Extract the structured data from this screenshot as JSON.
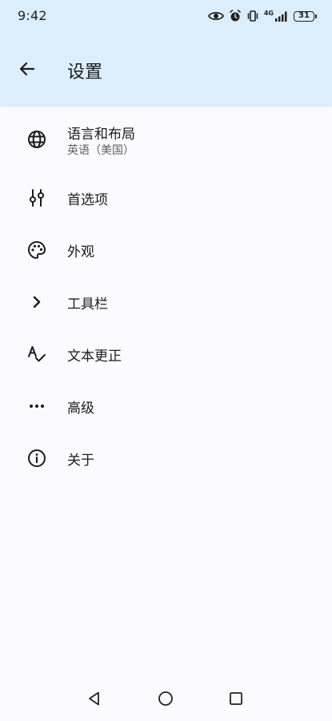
{
  "status_bar": {
    "time": "9:42",
    "network": "4G",
    "battery": "31",
    "icons": [
      "eye-icon",
      "alarm-icon",
      "vibrate-icon",
      "signal-icon",
      "battery-icon"
    ]
  },
  "app_bar": {
    "title": "设置",
    "back_icon": "arrow-back-icon"
  },
  "settings": {
    "items": [
      {
        "label": "语言和布局",
        "sublabel": "英语（美国）",
        "icon": "globe-icon"
      },
      {
        "label": "首选项",
        "icon": "tune-icon"
      },
      {
        "label": "外观",
        "icon": "palette-icon"
      },
      {
        "label": "工具栏",
        "icon": "chevron-right-icon"
      },
      {
        "label": "文本更正",
        "icon": "spellcheck-icon"
      },
      {
        "label": "高级",
        "icon": "more-horiz-icon"
      },
      {
        "label": "关于",
        "icon": "info-icon"
      }
    ]
  },
  "nav_bar": {
    "icons": [
      "nav-back-icon",
      "nav-home-icon",
      "nav-recents-icon"
    ]
  },
  "colors": {
    "app_bar_bg": "#dcedfb",
    "background": "#fbfbff",
    "text_primary": "#1b1b1f",
    "text_secondary": "#5e5e66"
  }
}
